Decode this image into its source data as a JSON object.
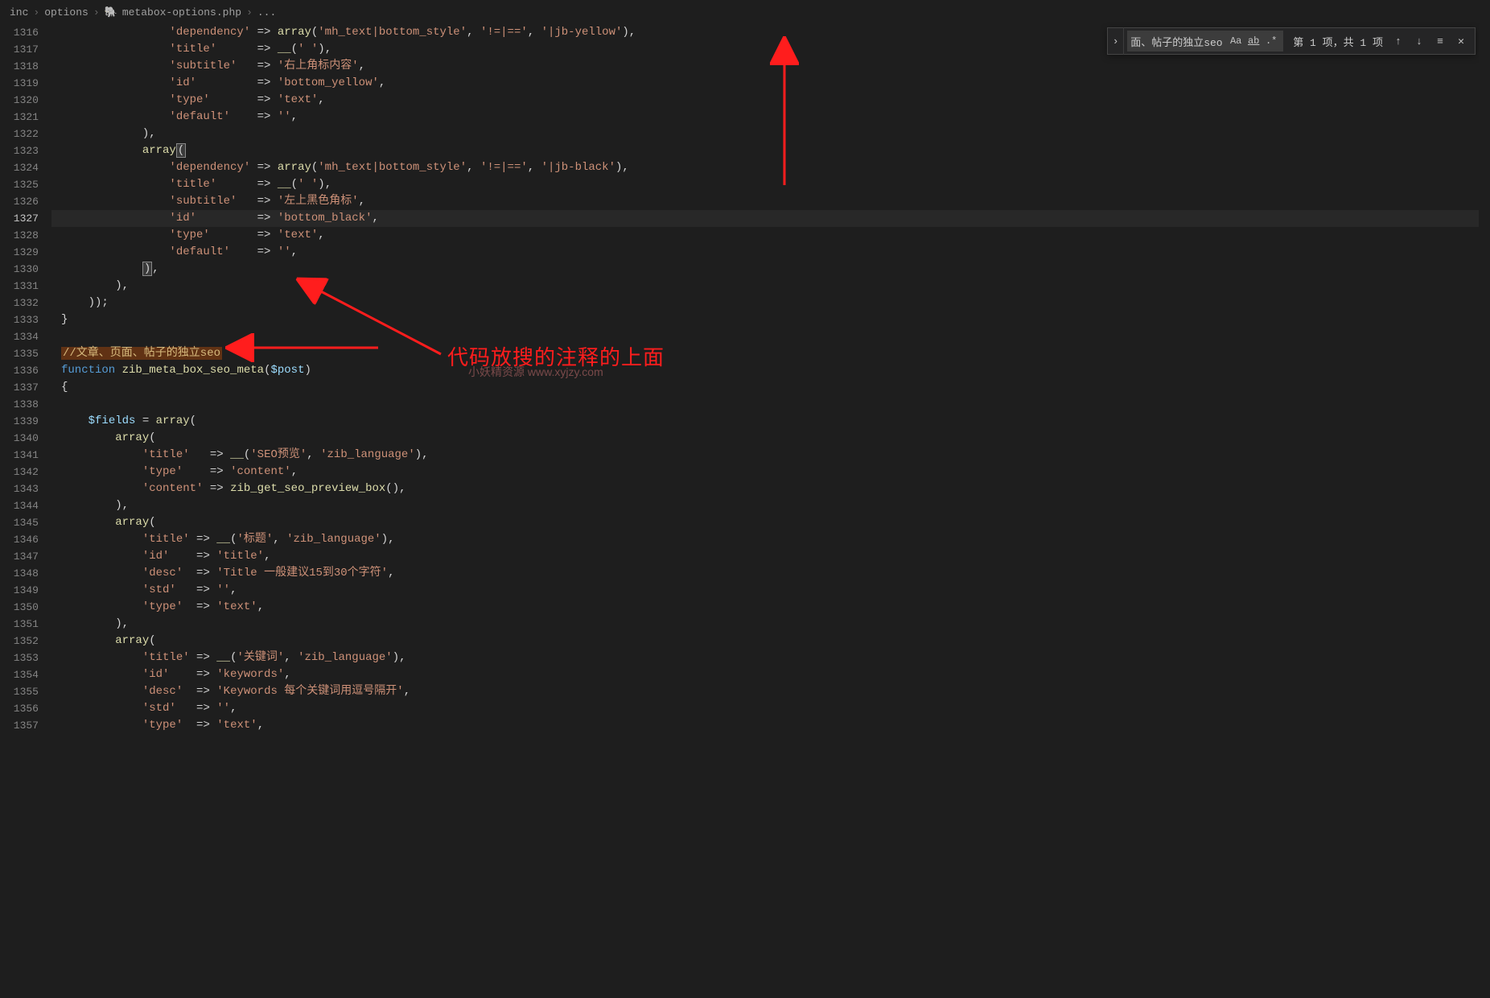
{
  "breadcrumb": {
    "seg1": "inc",
    "seg2": "options",
    "seg3": "metabox-options.php",
    "seg4": "..."
  },
  "find": {
    "query": "面、帖子的独立seo",
    "opt_case": "Aa",
    "opt_word": "ab",
    "opt_regex": ".*",
    "results": "第 1 项，共 1 项"
  },
  "gutter": {
    "start": 1316,
    "end": 1357,
    "active": 1327
  },
  "annotations": {
    "main_text": "代码放搜的注释的上面",
    "watermark": "小妖精资源 www.xyjzy.com"
  },
  "code_lines": [
    {
      "n": 1316,
      "segs": [
        {
          "t": "                ",
          "c": ""
        },
        {
          "t": "'dependency'",
          "c": "tk-str"
        },
        {
          "t": " => ",
          "c": "tk-op"
        },
        {
          "t": "array",
          "c": "tk-call"
        },
        {
          "t": "(",
          "c": "tk-punc"
        },
        {
          "t": "'mh_text|bottom_style'",
          "c": "tk-str"
        },
        {
          "t": ", ",
          "c": "tk-punc"
        },
        {
          "t": "'!=|=='",
          "c": "tk-str"
        },
        {
          "t": ", ",
          "c": "tk-punc"
        },
        {
          "t": "'|jb-yellow'",
          "c": "tk-str"
        },
        {
          "t": "),",
          "c": "tk-punc"
        }
      ]
    },
    {
      "n": 1317,
      "segs": [
        {
          "t": "                ",
          "c": ""
        },
        {
          "t": "'title'",
          "c": "tk-str"
        },
        {
          "t": "      => ",
          "c": "tk-op"
        },
        {
          "t": "__",
          "c": "tk-call"
        },
        {
          "t": "(",
          "c": "tk-punc"
        },
        {
          "t": "' '",
          "c": "tk-str"
        },
        {
          "t": "),",
          "c": "tk-punc"
        }
      ]
    },
    {
      "n": 1318,
      "segs": [
        {
          "t": "                ",
          "c": ""
        },
        {
          "t": "'subtitle'",
          "c": "tk-str"
        },
        {
          "t": "   => ",
          "c": "tk-op"
        },
        {
          "t": "'右上角标内容'",
          "c": "tk-str"
        },
        {
          "t": ",",
          "c": "tk-punc"
        }
      ]
    },
    {
      "n": 1319,
      "segs": [
        {
          "t": "                ",
          "c": ""
        },
        {
          "t": "'id'",
          "c": "tk-str"
        },
        {
          "t": "         => ",
          "c": "tk-op"
        },
        {
          "t": "'bottom_yellow'",
          "c": "tk-str"
        },
        {
          "t": ",",
          "c": "tk-punc"
        }
      ]
    },
    {
      "n": 1320,
      "segs": [
        {
          "t": "                ",
          "c": ""
        },
        {
          "t": "'type'",
          "c": "tk-str"
        },
        {
          "t": "       => ",
          "c": "tk-op"
        },
        {
          "t": "'text'",
          "c": "tk-str"
        },
        {
          "t": ",",
          "c": "tk-punc"
        }
      ]
    },
    {
      "n": 1321,
      "segs": [
        {
          "t": "                ",
          "c": ""
        },
        {
          "t": "'default'",
          "c": "tk-str"
        },
        {
          "t": "    => ",
          "c": "tk-op"
        },
        {
          "t": "''",
          "c": "tk-str"
        },
        {
          "t": ",",
          "c": "tk-punc"
        }
      ]
    },
    {
      "n": 1322,
      "segs": [
        {
          "t": "            ),",
          "c": "tk-punc"
        }
      ]
    },
    {
      "n": 1323,
      "segs": [
        {
          "t": "            ",
          "c": ""
        },
        {
          "t": "array",
          "c": "tk-call"
        },
        {
          "t": "(",
          "c": "match-bracket"
        }
      ]
    },
    {
      "n": 1324,
      "segs": [
        {
          "t": "                ",
          "c": ""
        },
        {
          "t": "'dependency'",
          "c": "tk-str"
        },
        {
          "t": " => ",
          "c": "tk-op"
        },
        {
          "t": "array",
          "c": "tk-call"
        },
        {
          "t": "(",
          "c": "tk-punc"
        },
        {
          "t": "'mh_text|bottom_style'",
          "c": "tk-str"
        },
        {
          "t": ", ",
          "c": "tk-punc"
        },
        {
          "t": "'!=|=='",
          "c": "tk-str"
        },
        {
          "t": ", ",
          "c": "tk-punc"
        },
        {
          "t": "'|jb-black'",
          "c": "tk-str"
        },
        {
          "t": "),",
          "c": "tk-punc"
        }
      ]
    },
    {
      "n": 1325,
      "segs": [
        {
          "t": "                ",
          "c": ""
        },
        {
          "t": "'title'",
          "c": "tk-str"
        },
        {
          "t": "      => ",
          "c": "tk-op"
        },
        {
          "t": "__",
          "c": "tk-call"
        },
        {
          "t": "(",
          "c": "tk-punc"
        },
        {
          "t": "' '",
          "c": "tk-str"
        },
        {
          "t": "),",
          "c": "tk-punc"
        }
      ]
    },
    {
      "n": 1326,
      "segs": [
        {
          "t": "                ",
          "c": ""
        },
        {
          "t": "'subtitle'",
          "c": "tk-str"
        },
        {
          "t": "   => ",
          "c": "tk-op"
        },
        {
          "t": "'左上黑色角标'",
          "c": "tk-str"
        },
        {
          "t": ",",
          "c": "tk-punc"
        }
      ]
    },
    {
      "n": 1327,
      "current": true,
      "segs": [
        {
          "t": "                ",
          "c": ""
        },
        {
          "t": "'id'",
          "c": "tk-str"
        },
        {
          "t": "         => ",
          "c": "tk-op"
        },
        {
          "t": "'bottom_black'",
          "c": "tk-str"
        },
        {
          "t": ",",
          "c": "tk-punc"
        }
      ]
    },
    {
      "n": 1328,
      "segs": [
        {
          "t": "                ",
          "c": ""
        },
        {
          "t": "'type'",
          "c": "tk-str"
        },
        {
          "t": "       => ",
          "c": "tk-op"
        },
        {
          "t": "'text'",
          "c": "tk-str"
        },
        {
          "t": ",",
          "c": "tk-punc"
        }
      ]
    },
    {
      "n": 1329,
      "segs": [
        {
          "t": "                ",
          "c": ""
        },
        {
          "t": "'default'",
          "c": "tk-str"
        },
        {
          "t": "    => ",
          "c": "tk-op"
        },
        {
          "t": "''",
          "c": "tk-str"
        },
        {
          "t": ",",
          "c": "tk-punc"
        }
      ]
    },
    {
      "n": 1330,
      "segs": [
        {
          "t": "            ",
          "c": ""
        },
        {
          "t": ")",
          "c": "match-bracket"
        },
        {
          "t": ",",
          "c": "tk-punc"
        }
      ]
    },
    {
      "n": 1331,
      "segs": [
        {
          "t": "        ),",
          "c": "tk-punc"
        }
      ]
    },
    {
      "n": 1332,
      "segs": [
        {
          "t": "    ));",
          "c": "tk-punc"
        }
      ]
    },
    {
      "n": 1333,
      "segs": [
        {
          "t": "}",
          "c": "tk-punc"
        }
      ]
    },
    {
      "n": 1334,
      "segs": [
        {
          "t": "",
          "c": ""
        }
      ]
    },
    {
      "n": 1335,
      "segs": [
        {
          "t": "//文章、页面、帖子的独立seo",
          "c": "highlight-comment"
        }
      ]
    },
    {
      "n": 1336,
      "segs": [
        {
          "t": "function",
          "c": "tk-key"
        },
        {
          "t": " ",
          "c": ""
        },
        {
          "t": "zib_meta_box_seo_meta",
          "c": "tk-fn"
        },
        {
          "t": "(",
          "c": "tk-punc"
        },
        {
          "t": "$post",
          "c": "tk-var"
        },
        {
          "t": ")",
          "c": "tk-punc"
        }
      ]
    },
    {
      "n": 1337,
      "segs": [
        {
          "t": "{",
          "c": "tk-punc"
        }
      ]
    },
    {
      "n": 1338,
      "segs": [
        {
          "t": "",
          "c": ""
        }
      ]
    },
    {
      "n": 1339,
      "segs": [
        {
          "t": "    ",
          "c": ""
        },
        {
          "t": "$fields",
          "c": "tk-var"
        },
        {
          "t": " = ",
          "c": "tk-op"
        },
        {
          "t": "array",
          "c": "tk-call"
        },
        {
          "t": "(",
          "c": "tk-punc"
        }
      ]
    },
    {
      "n": 1340,
      "segs": [
        {
          "t": "        ",
          "c": ""
        },
        {
          "t": "array",
          "c": "tk-call"
        },
        {
          "t": "(",
          "c": "tk-punc"
        }
      ]
    },
    {
      "n": 1341,
      "segs": [
        {
          "t": "            ",
          "c": ""
        },
        {
          "t": "'title'",
          "c": "tk-str"
        },
        {
          "t": "   => ",
          "c": "tk-op"
        },
        {
          "t": "__",
          "c": "tk-call"
        },
        {
          "t": "(",
          "c": "tk-punc"
        },
        {
          "t": "'SEO预览'",
          "c": "tk-str"
        },
        {
          "t": ", ",
          "c": "tk-punc"
        },
        {
          "t": "'zib_language'",
          "c": "tk-str"
        },
        {
          "t": "),",
          "c": "tk-punc"
        }
      ]
    },
    {
      "n": 1342,
      "segs": [
        {
          "t": "            ",
          "c": ""
        },
        {
          "t": "'type'",
          "c": "tk-str"
        },
        {
          "t": "    => ",
          "c": "tk-op"
        },
        {
          "t": "'content'",
          "c": "tk-str"
        },
        {
          "t": ",",
          "c": "tk-punc"
        }
      ]
    },
    {
      "n": 1343,
      "segs": [
        {
          "t": "            ",
          "c": ""
        },
        {
          "t": "'content'",
          "c": "tk-str"
        },
        {
          "t": " => ",
          "c": "tk-op"
        },
        {
          "t": "zib_get_seo_preview_box",
          "c": "tk-call"
        },
        {
          "t": "(),",
          "c": "tk-punc"
        }
      ]
    },
    {
      "n": 1344,
      "segs": [
        {
          "t": "        ),",
          "c": "tk-punc"
        }
      ]
    },
    {
      "n": 1345,
      "segs": [
        {
          "t": "        ",
          "c": ""
        },
        {
          "t": "array",
          "c": "tk-call"
        },
        {
          "t": "(",
          "c": "tk-punc"
        }
      ]
    },
    {
      "n": 1346,
      "segs": [
        {
          "t": "            ",
          "c": ""
        },
        {
          "t": "'title'",
          "c": "tk-str"
        },
        {
          "t": " => ",
          "c": "tk-op"
        },
        {
          "t": "__",
          "c": "tk-call"
        },
        {
          "t": "(",
          "c": "tk-punc"
        },
        {
          "t": "'标题'",
          "c": "tk-str"
        },
        {
          "t": ", ",
          "c": "tk-punc"
        },
        {
          "t": "'zib_language'",
          "c": "tk-str"
        },
        {
          "t": "),",
          "c": "tk-punc"
        }
      ]
    },
    {
      "n": 1347,
      "segs": [
        {
          "t": "            ",
          "c": ""
        },
        {
          "t": "'id'",
          "c": "tk-str"
        },
        {
          "t": "    => ",
          "c": "tk-op"
        },
        {
          "t": "'title'",
          "c": "tk-str"
        },
        {
          "t": ",",
          "c": "tk-punc"
        }
      ]
    },
    {
      "n": 1348,
      "segs": [
        {
          "t": "            ",
          "c": ""
        },
        {
          "t": "'desc'",
          "c": "tk-str"
        },
        {
          "t": "  => ",
          "c": "tk-op"
        },
        {
          "t": "'Title 一般建议15到30个字符'",
          "c": "tk-str"
        },
        {
          "t": ",",
          "c": "tk-punc"
        }
      ]
    },
    {
      "n": 1349,
      "segs": [
        {
          "t": "            ",
          "c": ""
        },
        {
          "t": "'std'",
          "c": "tk-str"
        },
        {
          "t": "   => ",
          "c": "tk-op"
        },
        {
          "t": "''",
          "c": "tk-str"
        },
        {
          "t": ",",
          "c": "tk-punc"
        }
      ]
    },
    {
      "n": 1350,
      "segs": [
        {
          "t": "            ",
          "c": ""
        },
        {
          "t": "'type'",
          "c": "tk-str"
        },
        {
          "t": "  => ",
          "c": "tk-op"
        },
        {
          "t": "'text'",
          "c": "tk-str"
        },
        {
          "t": ",",
          "c": "tk-punc"
        }
      ]
    },
    {
      "n": 1351,
      "segs": [
        {
          "t": "        ),",
          "c": "tk-punc"
        }
      ]
    },
    {
      "n": 1352,
      "segs": [
        {
          "t": "        ",
          "c": ""
        },
        {
          "t": "array",
          "c": "tk-call"
        },
        {
          "t": "(",
          "c": "tk-punc"
        }
      ]
    },
    {
      "n": 1353,
      "segs": [
        {
          "t": "            ",
          "c": ""
        },
        {
          "t": "'title'",
          "c": "tk-str"
        },
        {
          "t": " => ",
          "c": "tk-op"
        },
        {
          "t": "__",
          "c": "tk-call"
        },
        {
          "t": "(",
          "c": "tk-punc"
        },
        {
          "t": "'关键词'",
          "c": "tk-str"
        },
        {
          "t": ", ",
          "c": "tk-punc"
        },
        {
          "t": "'zib_language'",
          "c": "tk-str"
        },
        {
          "t": "),",
          "c": "tk-punc"
        }
      ]
    },
    {
      "n": 1354,
      "segs": [
        {
          "t": "            ",
          "c": ""
        },
        {
          "t": "'id'",
          "c": "tk-str"
        },
        {
          "t": "    => ",
          "c": "tk-op"
        },
        {
          "t": "'keywords'",
          "c": "tk-str"
        },
        {
          "t": ",",
          "c": "tk-punc"
        }
      ]
    },
    {
      "n": 1355,
      "segs": [
        {
          "t": "            ",
          "c": ""
        },
        {
          "t": "'desc'",
          "c": "tk-str"
        },
        {
          "t": "  => ",
          "c": "tk-op"
        },
        {
          "t": "'Keywords 每个关键词用逗号隔开'",
          "c": "tk-str"
        },
        {
          "t": ",",
          "c": "tk-punc"
        }
      ]
    },
    {
      "n": 1356,
      "segs": [
        {
          "t": "            ",
          "c": ""
        },
        {
          "t": "'std'",
          "c": "tk-str"
        },
        {
          "t": "   => ",
          "c": "tk-op"
        },
        {
          "t": "''",
          "c": "tk-str"
        },
        {
          "t": ",",
          "c": "tk-punc"
        }
      ]
    },
    {
      "n": 1357,
      "segs": [
        {
          "t": "            ",
          "c": ""
        },
        {
          "t": "'type'",
          "c": "tk-str"
        },
        {
          "t": "  => ",
          "c": "tk-op"
        },
        {
          "t": "'text'",
          "c": "tk-str"
        },
        {
          "t": ",",
          "c": "tk-punc"
        }
      ]
    }
  ]
}
